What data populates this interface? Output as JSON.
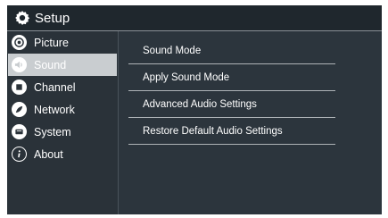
{
  "header": {
    "title": "Setup"
  },
  "sidebar": {
    "items": [
      {
        "label": "Picture",
        "icon": "picture-icon"
      },
      {
        "label": "Sound",
        "icon": "sound-icon",
        "active": true
      },
      {
        "label": "Channel",
        "icon": "channel-icon"
      },
      {
        "label": "Network",
        "icon": "network-icon"
      },
      {
        "label": "System",
        "icon": "system-icon"
      },
      {
        "label": "About",
        "icon": "about-icon"
      }
    ]
  },
  "main": {
    "options": [
      {
        "label": "Sound Mode"
      },
      {
        "label": "Apply Sound Mode"
      },
      {
        "label": "Advanced Audio Settings"
      },
      {
        "label": "Restore Default Audio Settings"
      }
    ]
  },
  "colors": {
    "frame": "#2c353d",
    "title_bar": "#1f272d",
    "active_item": "#c9cdd0",
    "text": "#ffffff"
  }
}
